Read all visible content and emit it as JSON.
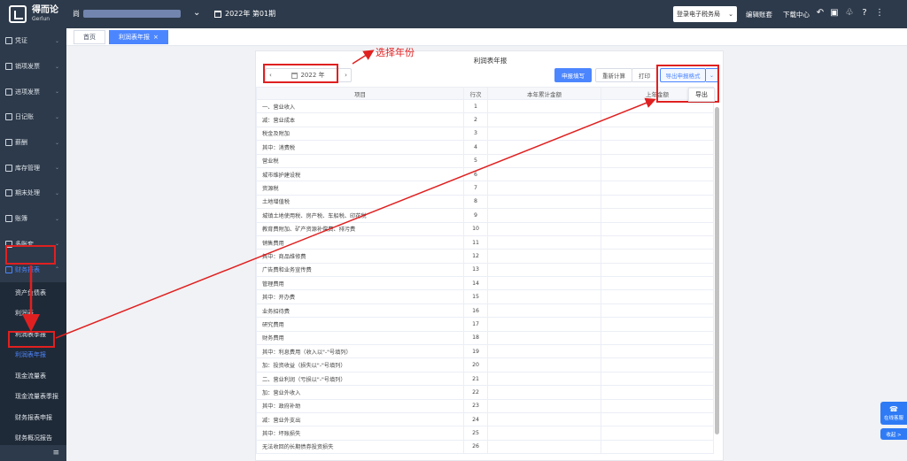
{
  "topbar": {
    "logo_cn": "得而论",
    "logo_en": "Gerlun",
    "company_prefix": "尚",
    "period": "2022年 第01期",
    "tax_login": "登录电子税务局",
    "edit_account": "编辑账套",
    "download_center": "下载中心"
  },
  "sidebar": {
    "items": [
      {
        "label": "凭证"
      },
      {
        "label": "销项发票"
      },
      {
        "label": "进项发票"
      },
      {
        "label": "日记账"
      },
      {
        "label": "薪酬"
      },
      {
        "label": "库存管理"
      },
      {
        "label": "期末处理"
      },
      {
        "label": "账簿"
      },
      {
        "label": "多账套"
      },
      {
        "label": "财务报表"
      }
    ],
    "sub_items": [
      {
        "label": "资产负债表"
      },
      {
        "label": "利润表"
      },
      {
        "label": "利润表季报"
      },
      {
        "label": "利润表年报"
      },
      {
        "label": "现金流量表"
      },
      {
        "label": "现金流量表季报"
      },
      {
        "label": "财务报表申报"
      },
      {
        "label": "财务概况报告"
      }
    ]
  },
  "tabs": [
    {
      "label": "首页"
    },
    {
      "label": "利润表年报"
    }
  ],
  "report": {
    "title": "利润表年报",
    "year": "2022 年",
    "btn_declare": "申报填写",
    "btn_recalc": "重新计算",
    "btn_print": "打印",
    "btn_export_style": "导出申报格式",
    "dropdown_export": "导出",
    "columns": [
      "项目",
      "行次",
      "本年累计金额",
      "上年金额"
    ],
    "rows": [
      {
        "item": "一、营业收入",
        "line": "1"
      },
      {
        "item": "减：营业成本",
        "line": "2"
      },
      {
        "item": "税金及附加",
        "line": "3"
      },
      {
        "item": "其中：消费税",
        "line": "4"
      },
      {
        "item": "营业税",
        "line": "5"
      },
      {
        "item": "城市维护建设税",
        "line": "6"
      },
      {
        "item": "资源税",
        "line": "7"
      },
      {
        "item": "土地增值税",
        "line": "8"
      },
      {
        "item": "城镇土地使用税、房产税、车船税、印花税",
        "line": "9"
      },
      {
        "item": "教育费附加、矿产资源补偿费、排污费",
        "line": "10"
      },
      {
        "item": "销售费用",
        "line": "11"
      },
      {
        "item": "其中：商品维修费",
        "line": "12"
      },
      {
        "item": "广告费和业务宣传费",
        "line": "13"
      },
      {
        "item": "管理费用",
        "line": "14"
      },
      {
        "item": "其中：开办费",
        "line": "15"
      },
      {
        "item": "业务招待费",
        "line": "16"
      },
      {
        "item": "研究费用",
        "line": "17"
      },
      {
        "item": "财务费用",
        "line": "18"
      },
      {
        "item": "其中：利息费用（收入以\"-\"号填列）",
        "line": "19"
      },
      {
        "item": "加：投资收益（损失以\"-\"号填列）",
        "line": "20"
      },
      {
        "item": "二、营业利润（亏损以\"-\"号填列）",
        "line": "21"
      },
      {
        "item": "加：营业外收入",
        "line": "22"
      },
      {
        "item": "其中：政府补助",
        "line": "23"
      },
      {
        "item": "减：营业外支出",
        "line": "24"
      },
      {
        "item": "其中：坏账损失",
        "line": "25"
      },
      {
        "item": "无法收回的长期债券投资损失",
        "line": "26"
      }
    ]
  },
  "annotation": {
    "select_year": "选择年份"
  },
  "service": {
    "online": "在线客服",
    "collapse": "收起 >"
  },
  "colors": {
    "sidebar_bg": "#2d3a4b",
    "accent": "#4c86ff",
    "annotation": "#e02020"
  }
}
